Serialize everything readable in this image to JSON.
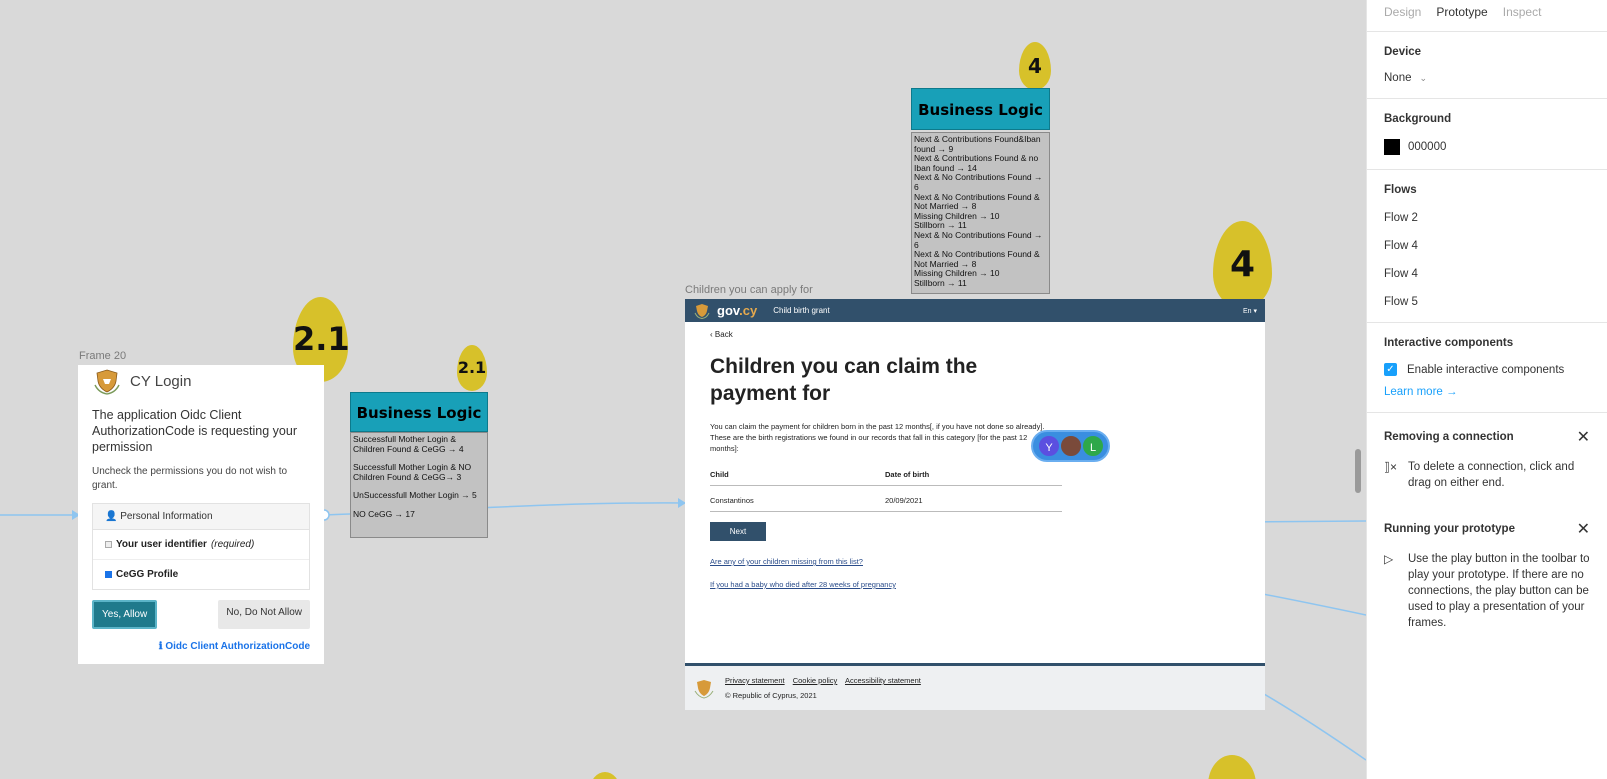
{
  "canvas": {
    "frame20_label": "Frame 20",
    "children_frame_label": "Children you can apply for",
    "badges": {
      "b21_large": "2.1",
      "b21_small": "2.1",
      "b4_small": "4",
      "b4_large": "4"
    }
  },
  "login": {
    "brand": "CY Login",
    "prompt": "The application Oidc Client AuthorizationCode is requesting your permission",
    "sub": "Uncheck the permissions you do not wish to grant.",
    "perm_header": "Personal Information",
    "perm_identifier": "Your user identifier",
    "perm_required": "(required)",
    "perm_cegg": "CeGG Profile",
    "allow": "Yes, Allow",
    "deny": "No, Do Not Allow",
    "client_link": "Oidc Client AuthorizationCode"
  },
  "business_logic_1": {
    "title": "Business Logic",
    "lines": [
      "Successfull Mother Login & Children Found & CeGG → 4",
      "Successfull Mother Login & NO Children Found & CeGG→ 3",
      "UnSuccessfull Mother Login → 5",
      "NO CeGG  → 17"
    ]
  },
  "business_logic_2": {
    "title": "Business Logic",
    "lines": [
      "Next & Contributions Found&Iban found → 9",
      "Next & Contributions Found & no Iban found → 14",
      "Next & No Contributions Found → 6",
      "Next & No Contributions Found & Not Married → 8",
      "Missing Children →  10",
      "Stillborn → 11",
      "Next & No Contributions Found → 6",
      "Next & No Contributions Found & Not Married → 8",
      "Missing Children →  10",
      "Stillborn → 11"
    ]
  },
  "gov": {
    "logo_main": "gov",
    "logo_cy": ".cy",
    "service": "Child birth grant",
    "lang": "En ▾",
    "back": "Back",
    "title": "Children you can claim the payment for",
    "para": "You can claim the payment for children born in the past 12 months[, if you have not done so already]. These are the birth registrations we found in our records that fall in this category [for the past 12 months]:",
    "col_child": "Child",
    "col_dob": "Date of birth",
    "row_child": "Constantinos",
    "row_dob": "20/09/2021",
    "next": "Next",
    "link_missing": "Are any of your children missing from this list?",
    "link_stillborn": "If you had a baby who died after 28 weeks of pregnancy",
    "footer_privacy": "Privacy statement",
    "footer_cookie": "Cookie policy",
    "footer_access": "Accessibility statement",
    "footer_copy": "© Republic of Cyprus, 2021"
  },
  "avatars": [
    {
      "letter": "Y",
      "color": "#5b4fe0"
    },
    {
      "letter": "",
      "color": "#7a4a3a"
    },
    {
      "letter": "L",
      "color": "#2ea84a"
    }
  ],
  "panel": {
    "tabs": [
      "Design",
      "Prototype",
      "Inspect"
    ],
    "device_title": "Device",
    "device_value": "None",
    "bg_title": "Background",
    "bg_value": "000000",
    "flows_title": "Flows",
    "flows": [
      "Flow 2",
      "Flow 4",
      "Flow 4",
      "Flow 5"
    ],
    "ic_title": "Interactive components",
    "ic_label": "Enable interactive components",
    "learn_more": "Learn more →",
    "remove_title": "Removing a connection",
    "remove_body": "To delete a connection, click and drag on either end.",
    "run_title": "Running your prototype",
    "run_body": "Use the play button in the toolbar to play your prototype. If there are no connections, the play button can be used to play a presentation of your frames."
  },
  "colors": {
    "accent": "#18a0fb",
    "connector": "#8ec5f0",
    "badge": "#d7c12a",
    "business_logic": "#18a0b8",
    "gov_bar": "#31506b"
  }
}
